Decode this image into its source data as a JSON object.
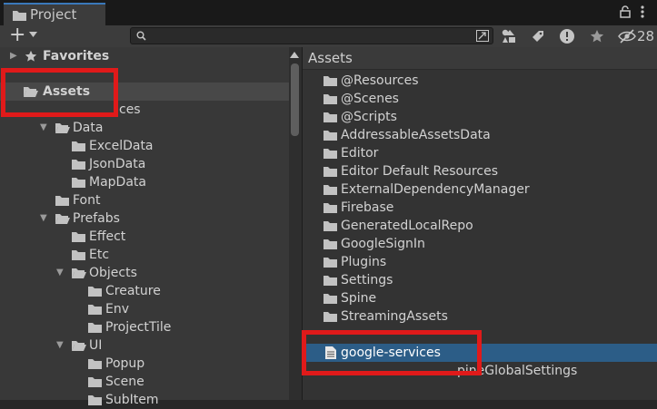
{
  "window": {
    "tab_title": "Project",
    "hidden_count": "28"
  },
  "toolbar": {
    "create_label": "+",
    "search_placeholder": ""
  },
  "tree": {
    "favorites_label": "Favorites",
    "assets_label": "Assets",
    "partial_label": "ces",
    "items": [
      {
        "label": "Data",
        "expanded": true
      },
      {
        "label": "ExcelData"
      },
      {
        "label": "JsonData"
      },
      {
        "label": "MapData"
      },
      {
        "label": "Font"
      },
      {
        "label": "Prefabs",
        "expanded": true
      },
      {
        "label": "Effect"
      },
      {
        "label": "Etc"
      },
      {
        "label": "Objects",
        "expanded": true
      },
      {
        "label": "Creature"
      },
      {
        "label": "Env"
      },
      {
        "label": "ProjectTile"
      },
      {
        "label": "UI",
        "expanded": true
      },
      {
        "label": "Popup"
      },
      {
        "label": "Scene"
      },
      {
        "label": "SubItem"
      }
    ]
  },
  "assets_panel": {
    "header": "Assets",
    "folders": [
      "@Resources",
      "@Scenes",
      "@Scripts",
      "AddressableAssetsData",
      "Editor",
      "Editor Default Resources",
      "ExternalDependencyManager",
      "Firebase",
      "GeneratedLocalRepo",
      "GoogleSignIn",
      "Plugins",
      "Settings",
      "Spine",
      "StreamingAssets"
    ],
    "selected_file": "google-services",
    "partial_file": "pineGlobalSettings"
  },
  "colors": {
    "selection": "#2c5d87",
    "callout": "#e01a1a",
    "folder": "#c2c2c2"
  }
}
